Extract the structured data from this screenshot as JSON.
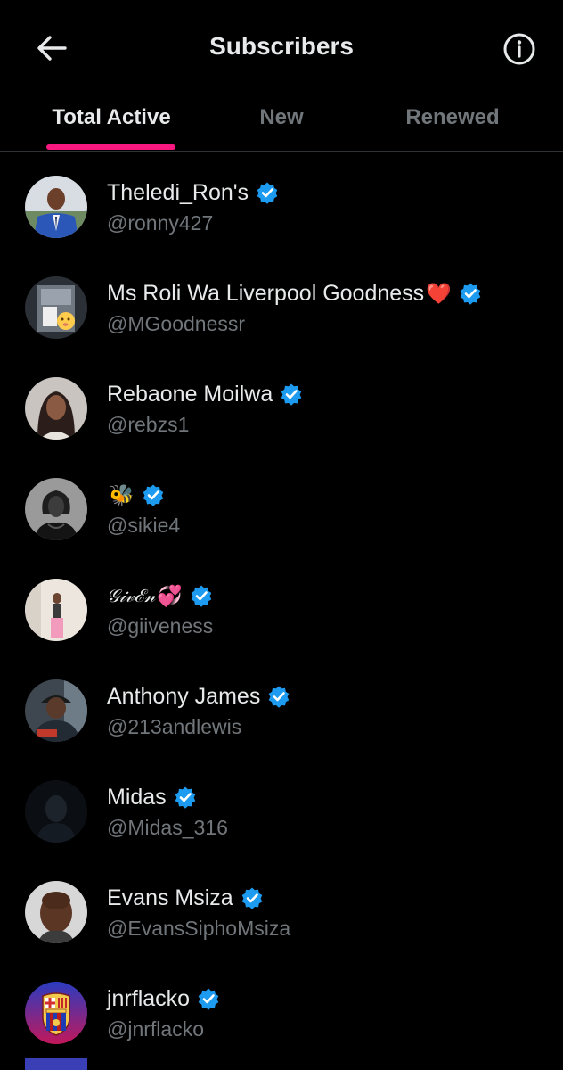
{
  "header": {
    "title": "Subscribers"
  },
  "tabs": [
    {
      "label": "Total Active",
      "active": true
    },
    {
      "label": "New",
      "active": false
    },
    {
      "label": "Renewed",
      "active": false
    }
  ],
  "colors": {
    "background": "#000000",
    "text_primary": "#e7e9ea",
    "text_secondary": "#71767b",
    "accent": "#f91880",
    "verified": "#1d9bf0"
  },
  "subscribers": [
    {
      "name": "Theledi_Ron's",
      "emoji": "",
      "handle": "@ronny427",
      "verified": true
    },
    {
      "name": "Ms Roli Wa Liverpool Goodness",
      "emoji": "❤️",
      "handle": "@MGoodnessr",
      "verified": true
    },
    {
      "name": "Rebaone Moilwa",
      "emoji": "",
      "handle": "@rebzs1",
      "verified": true
    },
    {
      "name": "",
      "emoji": "🐝",
      "handle": "@sikie4",
      "verified": true
    },
    {
      "name": "𝒢𝒾𝓋ℰ𝓃",
      "emoji": "💞",
      "handle": "@giiveness",
      "verified": true
    },
    {
      "name": "Anthony James",
      "emoji": "",
      "handle": "@213andlewis",
      "verified": true
    },
    {
      "name": "Midas",
      "emoji": "",
      "handle": "@Midas_316",
      "verified": true
    },
    {
      "name": "Evans Msiza",
      "emoji": "",
      "handle": "@EvansSiphoMsiza",
      "verified": true
    },
    {
      "name": "jnrflacko",
      "emoji": "",
      "handle": "@jnrflacko",
      "verified": true
    }
  ]
}
